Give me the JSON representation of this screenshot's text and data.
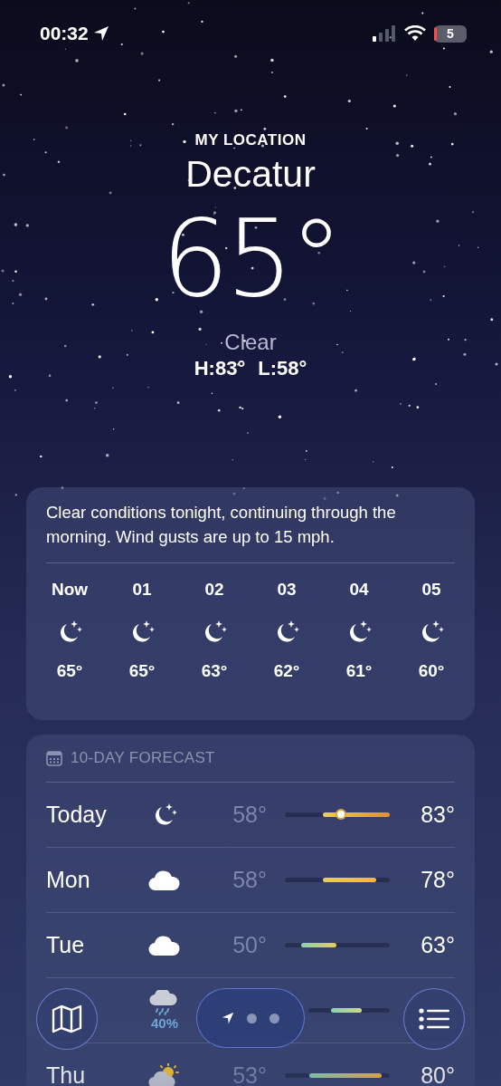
{
  "status_bar": {
    "time": "00:32",
    "battery": "5"
  },
  "header": {
    "location_label": "MY LOCATION",
    "city": "Decatur",
    "temperature": "65°",
    "condition": "Clear",
    "high": "H:83°",
    "low": "L:58°"
  },
  "hourly": {
    "summary": "Clear conditions tonight, continuing through the morning. Wind gusts are up to 15 mph.",
    "hours": [
      {
        "time": "Now",
        "kind": "moon",
        "temp": "65°"
      },
      {
        "time": "01",
        "kind": "moon",
        "temp": "65°"
      },
      {
        "time": "02",
        "kind": "moon",
        "temp": "63°"
      },
      {
        "time": "03",
        "kind": "moon",
        "temp": "62°"
      },
      {
        "time": "04",
        "kind": "moon",
        "temp": "61°"
      },
      {
        "time": "05",
        "kind": "moon",
        "temp": "60°"
      }
    ]
  },
  "forecast": {
    "title": "10-DAY FORECAST",
    "days": [
      {
        "day": "Today",
        "kind": "moon",
        "low": "58°",
        "high": "83°",
        "current": true
      },
      {
        "day": "Mon",
        "kind": "cloud",
        "low": "58°",
        "high": "78°",
        "current": false
      },
      {
        "day": "Tue",
        "kind": "cloud",
        "low": "50°",
        "high": "63°",
        "current": false
      },
      {
        "kind": "rain",
        "precip": "40%",
        "current": false
      },
      {
        "day": "Thu",
        "kind": "suncloud",
        "low": "53°",
        "high": "80°",
        "current": false
      }
    ]
  }
}
